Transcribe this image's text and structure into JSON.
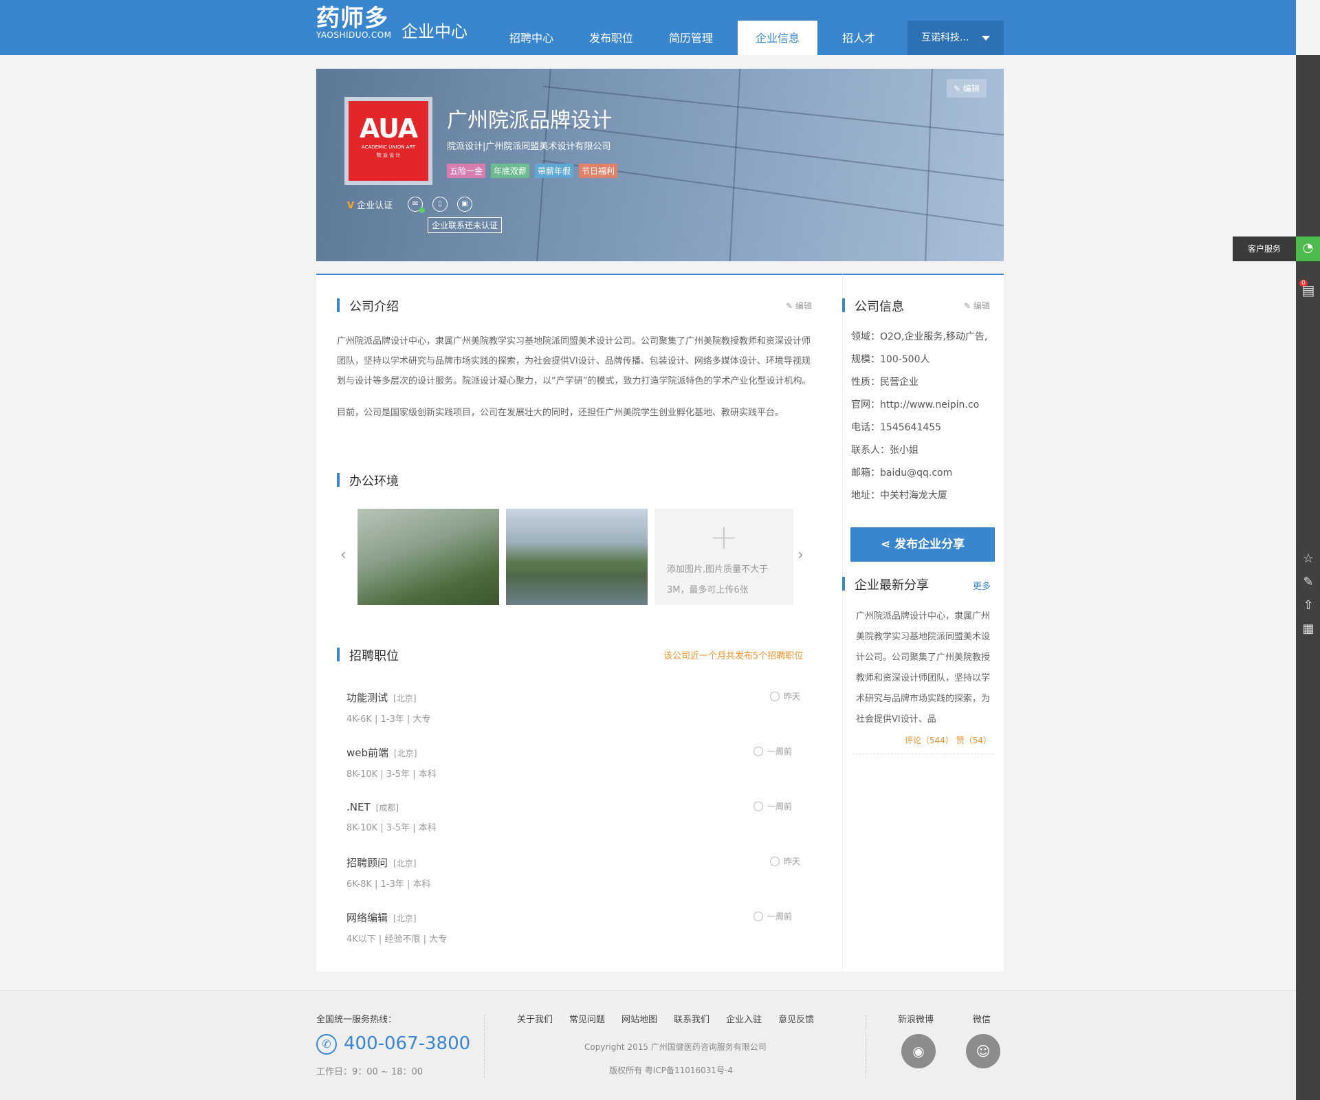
{
  "header": {
    "logo_cn": "药师多",
    "logo_en": "YAOSHIDUO.COM",
    "center_title": "企业中心",
    "nav": [
      {
        "label": "招聘中心"
      },
      {
        "label": "发布职位"
      },
      {
        "label": "简历管理"
      },
      {
        "label": "企业信息"
      },
      {
        "label": "招人才"
      }
    ],
    "active_nav": "企业信息",
    "account": "互诺科技...",
    "accent_color": "#3a86ce"
  },
  "right_rail": {
    "customer_service": "客户服务",
    "badge": "0"
  },
  "banner": {
    "edit": "编辑",
    "logo_big": "AUA",
    "logo_small_en": "ACADEMIC UNION ART",
    "logo_small_cn": "院 派 设 计",
    "company_name": "广州院派品牌设计",
    "company_sub": "院派设计|广州院派同盟美术设计有限公司",
    "tags": [
      {
        "label": "五险一金",
        "color": "#d87db0"
      },
      {
        "label": "年底双薪",
        "color": "#6cbc8f"
      },
      {
        "label": "带薪年假",
        "color": "#5fa8d4"
      },
      {
        "label": "节日福利",
        "color": "#e0816a"
      }
    ],
    "auth_label": "企业认证",
    "auth_v": "V",
    "tooltip": "企业联系还未认证"
  },
  "intro": {
    "title": "公司介绍",
    "edit": "编辑",
    "p1": "广州院派品牌设计中心，隶属广州美院教学实习基地院派同盟美术设计公司。公司聚集了广州美院教授教师和资深设计师团队，坚持以学术研究与品牌市场实践的探索，为社会提供VI设计、品牌传播、包装设计、网络多媒体设计、环境导视规划与设计等多层次的设计服务。院派设计凝心聚力，以“产学研”的模式，致力打造学院派特色的学术产业化型设计机构。",
    "p2": "目前，公司是国家级创新实践项目，公司在发展壮大的同时，还担任广州美院学生创业孵化基地、教研实践平台。"
  },
  "office": {
    "title": "办公环境",
    "add_text": "添加图片,图片质量不大于3M，最多可上传6张"
  },
  "jobs": {
    "title": "招聘职位",
    "note": "该公司近一个月共发布5个招聘职位",
    "items": [
      {
        "title": "功能测试",
        "city": "[北京]",
        "meta": "4K-6K  |  1-3年  |  大专",
        "time": "昨天"
      },
      {
        "title": "web前端",
        "city": "[北京]",
        "meta": "8K-10K  |  3-5年  |  本科",
        "time": "一周前"
      },
      {
        "title": ".NET",
        "city": "[成都]",
        "meta": "8K-10K  |  3-5年  |  本科",
        "time": "一周前"
      },
      {
        "title": "招聘顾问",
        "city": "[北京]",
        "meta": "6K-8K  |  1-3年  |  本科",
        "time": "昨天"
      },
      {
        "title": "网络编辑",
        "city": "[北京]",
        "meta": "4K以下  |  经验不限  |  大专",
        "time": "一周前"
      }
    ]
  },
  "company_info": {
    "title": "公司信息",
    "edit": "编辑",
    "rows": [
      "领域：O2O,企业服务,移动广告,",
      "规模：100-500人",
      "性质：民营企业",
      "官网：http://www.neipin.co",
      "电话：1545641455",
      "联系人：张小姐",
      "邮箱：baidu@qq.com",
      "地址：中关村海龙大厦"
    ]
  },
  "share": {
    "button": "发布企业分享",
    "title": "企业最新分享",
    "more": "更多",
    "text": "广州院派品牌设计中心，隶属广州美院教学实习基地院派同盟美术设计公司。公司聚集了广州美院教授教师和资深设计师团队，坚持以学术研究与品牌市场实践的探索，为社会提供VI设计、品",
    "stats": "评论（544）  赞（54）"
  },
  "footer": {
    "hotline_label": "全国统一服务热线：",
    "hotline": "400-067-3800",
    "hours": "工作日：9：00 ~ 18：00",
    "links": [
      "关于我们",
      "常见问题",
      "网站地图",
      "联系我们",
      "企业入驻",
      "意见反馈"
    ],
    "copyright": "Copyright 2015 广州国健医药咨询服务有限公司",
    "icp": "版权所有    粤ICP备11016031号-4",
    "weibo": "新浪微博",
    "wechat": "微信"
  }
}
